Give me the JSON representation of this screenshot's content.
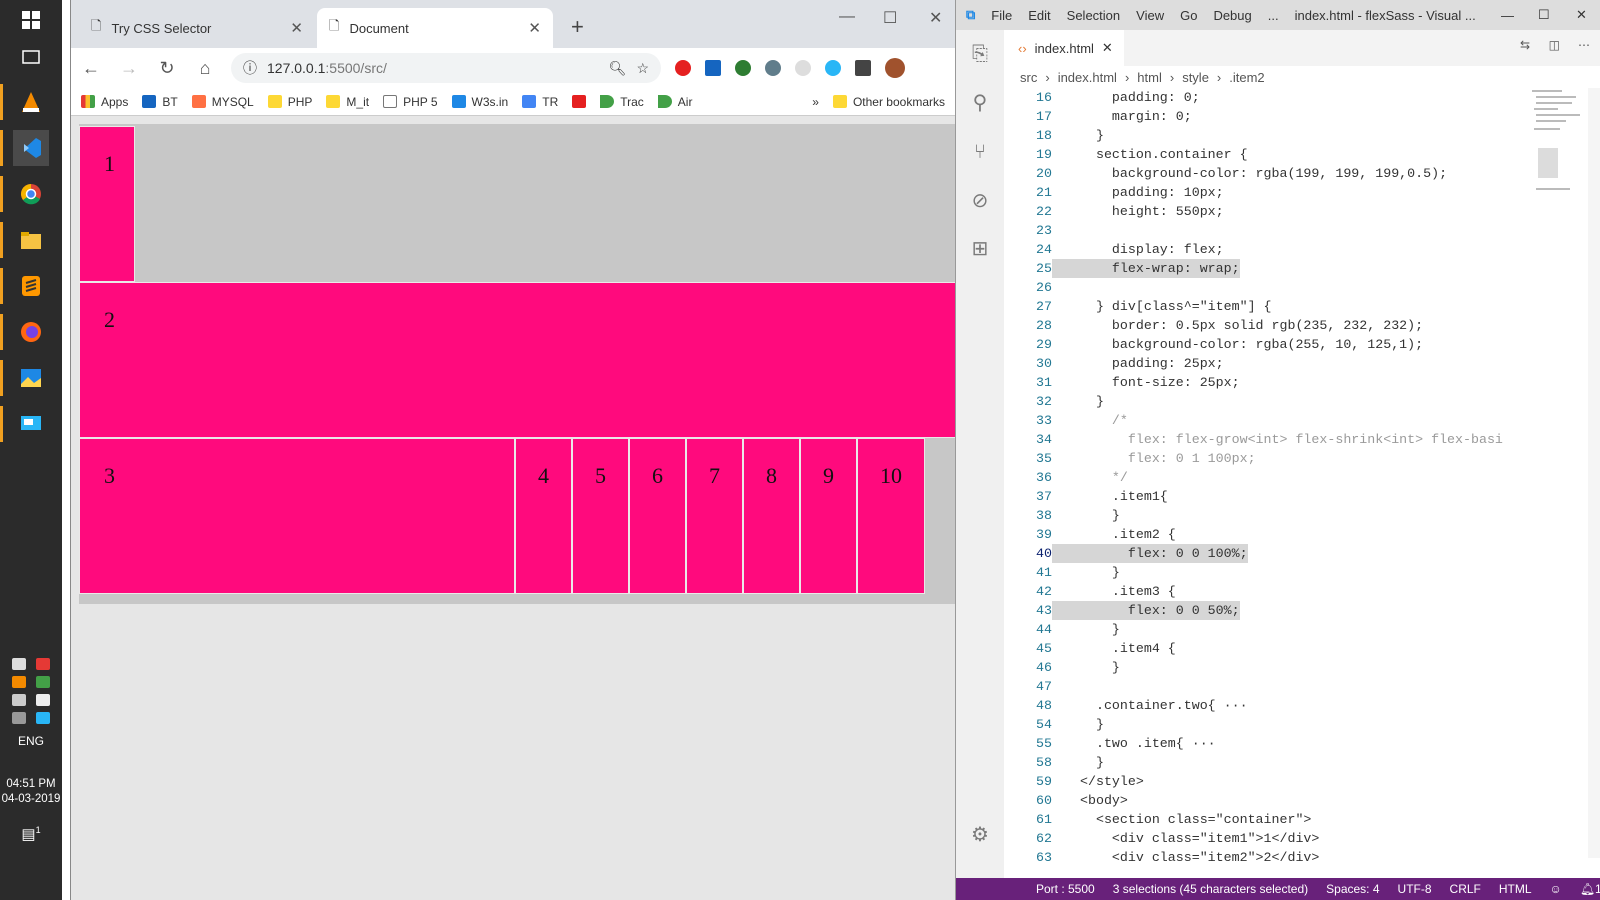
{
  "taskbar": {
    "lang": "ENG",
    "time": "04:51 PM",
    "date": "04-03-2019",
    "notif_count": "1"
  },
  "browser": {
    "tabs": [
      {
        "label": "Try CSS Selector"
      },
      {
        "label": "Document"
      }
    ],
    "url_host": "127.0.0.1",
    "url_rest": ":5500/src/",
    "bookmarks": [
      "Apps",
      "BT",
      "MYSQL",
      "PHP",
      "M_it",
      "PHP 5",
      "W3s.in",
      "TR",
      "Trac",
      "Air"
    ],
    "more": "»",
    "other": "Other bookmarks",
    "items": [
      "1",
      "2",
      "3",
      "4",
      "5",
      "6",
      "7",
      "8",
      "9",
      "10"
    ],
    "colors": {
      "item": "#ff0a7d",
      "container": "#c7c7c7"
    }
  },
  "vscode": {
    "menu": [
      "File",
      "Edit",
      "Selection",
      "View",
      "Go",
      "Debug",
      "..."
    ],
    "title": "index.html - flexSass - Visual ...",
    "tab": "index.html",
    "crumbs": [
      "src",
      "index.html",
      "html",
      "style",
      ".item2"
    ],
    "lines": [
      {
        "n": "16",
        "t": "    padding: 0;"
      },
      {
        "n": "17",
        "t": "    margin: 0;"
      },
      {
        "n": "18",
        "t": "  }"
      },
      {
        "n": "19",
        "t": "  section.container {"
      },
      {
        "n": "20",
        "t": "    background-color: rgba(199, 199, 199,0.5);"
      },
      {
        "n": "21",
        "t": "    padding: 10px;"
      },
      {
        "n": "22",
        "t": "    height: 550px;"
      },
      {
        "n": "23",
        "t": ""
      },
      {
        "n": "24",
        "t": "    display: flex;"
      },
      {
        "n": "25",
        "t": "    flex-wrap: wrap;"
      },
      {
        "n": "26",
        "t": ""
      },
      {
        "n": "27",
        "t": "  } div[class^=\"item\"] {"
      },
      {
        "n": "28",
        "t": "    border: 0.5px solid rgb(235, 232, 232);"
      },
      {
        "n": "29",
        "t": "    background-color: rgba(255, 10, 125,1);"
      },
      {
        "n": "30",
        "t": "    padding: 25px;"
      },
      {
        "n": "31",
        "t": "    font-size: 25px;"
      },
      {
        "n": "32",
        "t": "  }"
      },
      {
        "n": "33",
        "t": "    /*"
      },
      {
        "n": "34",
        "t": "      flex: flex-grow<int> flex-shrink<int> flex-basi"
      },
      {
        "n": "35",
        "t": "      flex: 0 1 100px;"
      },
      {
        "n": "36",
        "t": "    */"
      },
      {
        "n": "37",
        "t": "    .item1{"
      },
      {
        "n": "38",
        "t": "    }"
      },
      {
        "n": "39",
        "t": "    .item2 {"
      },
      {
        "n": "40",
        "t": "      flex: 0 0 100%;"
      },
      {
        "n": "41",
        "t": "    }"
      },
      {
        "n": "42",
        "t": "    .item3 {"
      },
      {
        "n": "43",
        "t": "      flex: 0 0 50%;"
      },
      {
        "n": "44",
        "t": "    }"
      },
      {
        "n": "45",
        "t": "    .item4 {"
      },
      {
        "n": "46",
        "t": "    }"
      },
      {
        "n": "47",
        "t": ""
      },
      {
        "n": "48",
        "t": "  .container.two{ ···"
      },
      {
        "n": "54",
        "t": "  }"
      },
      {
        "n": "55",
        "t": "  .two .item{ ···"
      },
      {
        "n": "58",
        "t": "  }"
      },
      {
        "n": "59",
        "t": "</style>"
      },
      {
        "n": "60",
        "t": "<body>"
      },
      {
        "n": "61",
        "t": "  <section class=\"container\">"
      },
      {
        "n": "62",
        "t": "    <div class=\"item1\">1</div>"
      },
      {
        "n": "63",
        "t": "    <div class=\"item2\">2</div>"
      }
    ],
    "status": {
      "port": "Port : 5500",
      "selections": "3 selections (45 characters selected)",
      "spaces": "Spaces: 4",
      "encoding": "UTF-8",
      "eol": "CRLF",
      "lang": "HTML",
      "bell": "1"
    }
  }
}
